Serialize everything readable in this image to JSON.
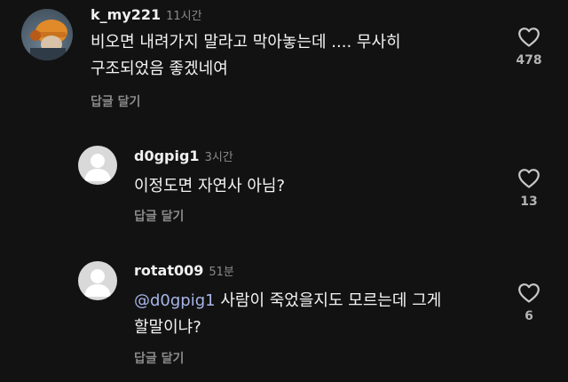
{
  "comments": [
    {
      "username": "k_my221",
      "time": "11시간",
      "line1": "비오면 내려가지 말라고 막아놓는데 .... 무사히",
      "line2": "구조되었음 좋겠네여",
      "reply_label": "답글 달기",
      "like_count": "478"
    },
    {
      "username": "d0gpig1",
      "time": "3시간",
      "line1": "이정도면 자연사 아님?",
      "reply_label": "답글 달기",
      "like_count": "13"
    },
    {
      "username": "rotat009",
      "time": "51분",
      "mention": "@d0gpig1",
      "line1_rest": " 사람이 죽었을지도 모르는데 그게",
      "line2": "할말이냐?",
      "reply_label": "답글 달기",
      "like_count": "6"
    }
  ],
  "icons": {
    "like": "heart-outline-icon",
    "default_avatar": "person-silhouette-icon"
  },
  "colors": {
    "background": "#121212",
    "mention": "#a8b6e8",
    "muted": "#8a8a8a"
  }
}
